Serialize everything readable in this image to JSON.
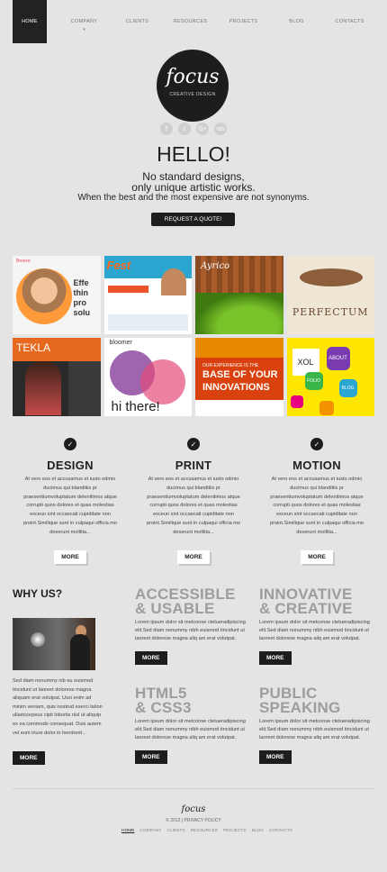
{
  "nav": {
    "items": [
      {
        "label": "HOME"
      },
      {
        "label": "COMPANY"
      },
      {
        "label": "CLIENTS"
      },
      {
        "label": "RESOURCES"
      },
      {
        "label": "PROJECTS"
      },
      {
        "label": "BLOG"
      },
      {
        "label": "CONTACTS"
      }
    ]
  },
  "logo": {
    "word": "focus",
    "tagline": "CREATIVE DESIGN"
  },
  "social": [
    "f",
    "t",
    "G+",
    "rss"
  ],
  "hero": {
    "title": "HELLO!",
    "line1": "No standard designs,",
    "line2": "only unique artistic works.",
    "line3": "When the best and the most expensive are not synonyms.",
    "cta": "REQUEST A QUOTE!"
  },
  "gallery": {
    "t1": {
      "brand": "Breeze",
      "big": "Effe thin pro solu"
    },
    "t2": {
      "brand": "Fest"
    },
    "t3": {
      "name": "Ayrico"
    },
    "t4": {
      "text": "PERFECTUM"
    },
    "t5": {
      "name": "TEKLA"
    },
    "t6": {
      "brand": "bloomer",
      "hi": "hi there!"
    },
    "t7": {
      "small": "OUR EXPERIENCE IS THE",
      "msg1": "BASE OF YOUR",
      "msg2": "INNOVATIONS"
    },
    "t8": {
      "xol": "XOL",
      "about": "ABOUT",
      "folio": "FOLIO",
      "blog": "BLOG"
    }
  },
  "services": [
    {
      "title": "DESIGN",
      "text": "At vero eos et accusamus et iusto odmio ducimus qui blanditiis pr praesentiumvoluptatum delenitimos atque corrupti quos dolores et quas molestias exceun sint occaecati cupiditate non proint.Similique sunt in culpaqui officia mo deserunt mollitia...",
      "more": "MORE"
    },
    {
      "title": "PRINT",
      "text": "At vero eos et accusamus et iusto odmio ducimus qui blanditiis pr praesentiumvoluptatum delenitimos atque corrupti quos dolores et quas molestias exceun sint occaecati cupiditate non proint.Similique sunt in culpaqui officia mo deserunt mollitia...",
      "more": "MORE"
    },
    {
      "title": "MOTION",
      "text": "At vero eos et accusamus et iusto odmio ducimus qui blanditiis pr praesentiumvoluptatum delenitimos atque corrupti quos dolores et quas molestias exceun sint occaecati cupiditate non proint.Similique sunt in culpaqui officia mo deserunt mollitia...",
      "more": "MORE"
    }
  ],
  "why": {
    "title": "WHY US?",
    "text": "Sed diam nonummy nib eu euismod tincidunt ut laoreet dolorese magna aliquam erat volutpat. Ussi enim ad minim veniam, quis nostrud exerci tation ullamcorpeus cipit lobortis nisl ut aliquip ex ea commodo consequat. Duis autem vel eum iriure dolor in hendrerit...",
    "more": "MORE"
  },
  "features": [
    {
      "line1": "ACCESSIBLE",
      "line2": "& USABLE",
      "text": "Lorem ipsum dolor sit metconse ctetueradipiscing elit.Sed diam nonummy nibh euismod tincidunt ut laoreet dolorese magna aliq am erat volutpat.",
      "more": "MORE"
    },
    {
      "line1": "INNOVATIVE",
      "line2": "& CREATIVE",
      "text": "Lorem ipsum dolor sit metconse ctetueradipiscing elit.Sed diam nonummy nibh euismod tincidunt ut laoreet dolorese magna aliq am erat volutpat.",
      "more": "MORE"
    },
    {
      "line1": "HTML5",
      "line2": "& CSS3",
      "text": "Lorem ipsum dolor sit metconse ctetueradipiscing elit.Sed diam nonummy nibh euismod tincidunt ut laoreet dolorese magna aliq am erat volutpat.",
      "more": "MORE"
    },
    {
      "line1": "PUBLIC",
      "line2": "SPEAKING",
      "text": "Lorem ipsum dolor sit metconse ctetueradipiscing elit.Sed diam nonummy nibh euismod tincidunt ut laoreet dolorese magna aliq am erat volutpat.",
      "more": "MORE"
    }
  ],
  "footer": {
    "logo": "focus",
    "copyright": "© 2012 | PRIVACY POLICY",
    "nav": [
      "HOME",
      "COMPANY",
      "CLIENTS",
      "RESOURCES",
      "PROJECTS",
      "BLOG",
      "CONTACTS"
    ]
  }
}
